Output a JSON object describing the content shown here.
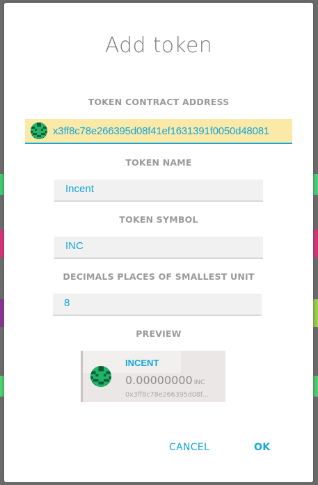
{
  "dialog": {
    "title": "Add token"
  },
  "fields": {
    "contract_address": {
      "label": "TOKEN CONTRACT ADDRESS",
      "value": "x3ff8c78e266395d08f41ef1631391f0050d48081"
    },
    "token_name": {
      "label": "TOKEN NAME",
      "value": "Incent"
    },
    "token_symbol": {
      "label": "TOKEN SYMBOL",
      "value": "INC"
    },
    "decimals": {
      "label": "DECIMALS PLACES OF SMALLEST UNIT",
      "value": "8"
    }
  },
  "preview": {
    "label": "PREVIEW",
    "name": "INCENT",
    "balance": "0.00000000",
    "unit": "INC",
    "address": "0x3ff8c78e266395d08f..."
  },
  "actions": {
    "cancel_label": "CANCEL",
    "ok_label": "OK"
  },
  "colors": {
    "accent": "#12a6dc",
    "address_highlight": "#fbe9a7",
    "identicon_green": "#1fb46a",
    "identicon_dark": "#0d5c34"
  },
  "icons": {
    "token_identicon": "token-identicon"
  }
}
